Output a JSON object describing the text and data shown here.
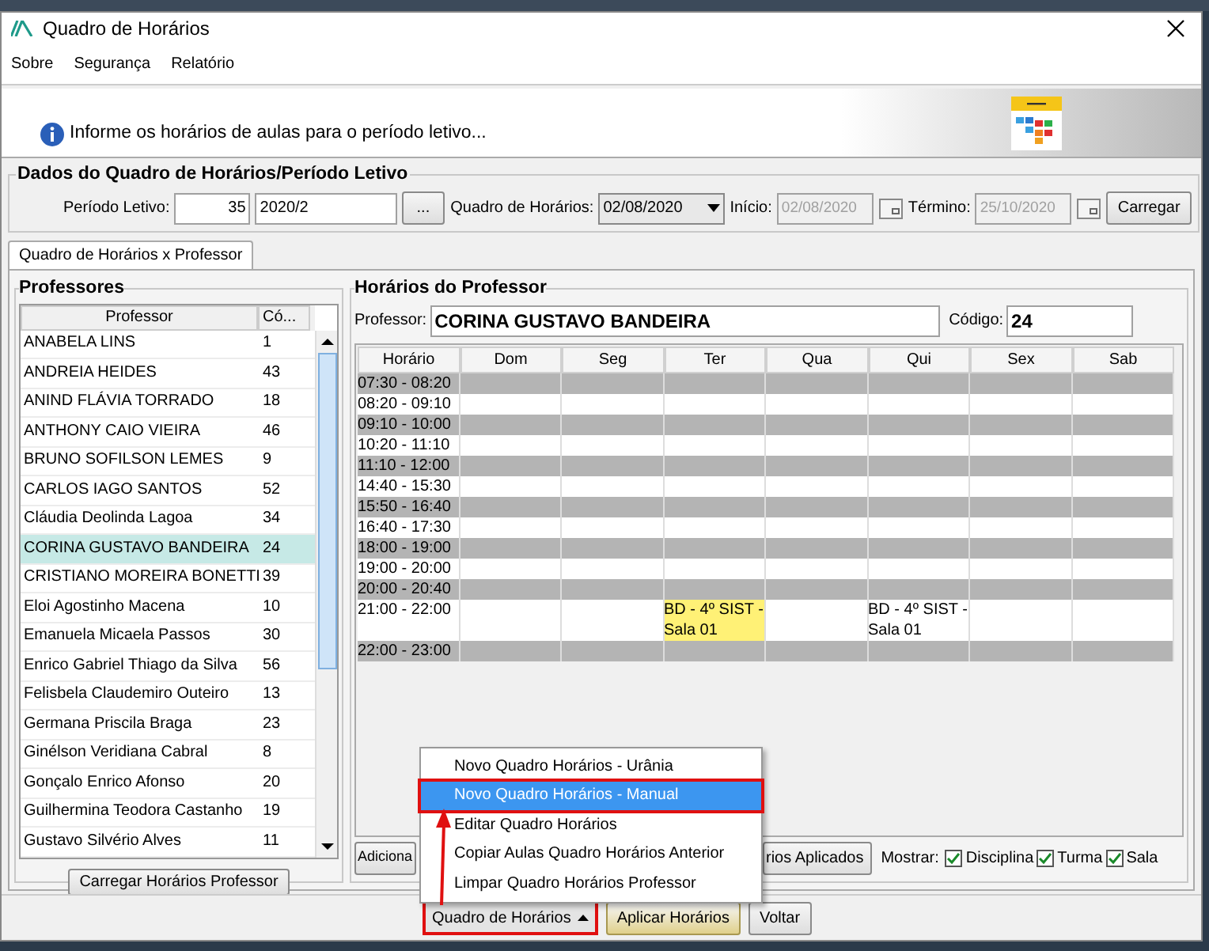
{
  "window": {
    "title": "Quadro de Horários"
  },
  "menu": [
    "Sobre",
    "Segurança",
    "Relatório"
  ],
  "info": "Informe os horários de aulas para o período letivo...",
  "period_group": {
    "title": "Dados do Quadro de Horários/Período Letivo",
    "periodo_label": "Período Letivo:",
    "periodo_code": "35",
    "periodo_value": "2020/2",
    "browse": "...",
    "quadro_label": "Quadro de Horários:",
    "quadro_value": "02/08/2020",
    "inicio_label": "Início:",
    "inicio_value": "02/08/2020",
    "termino_label": "Término:",
    "termino_value": "25/10/2020",
    "load": "Carregar"
  },
  "tabs": [
    {
      "label": "Quadro de Horários x Professor",
      "selected": true
    }
  ],
  "professors": {
    "title": "Professores",
    "columns": [
      "Professor",
      "Có..."
    ],
    "rows": [
      {
        "name": "ANABELA LINS",
        "code": "1",
        "selected": false
      },
      {
        "name": "ANDREIA HEIDES",
        "code": "43",
        "selected": false
      },
      {
        "name": "ANIND FLÁVIA TORRADO",
        "code": "18",
        "selected": false
      },
      {
        "name": "ANTHONY CAIO VIEIRA",
        "code": "46",
        "selected": false
      },
      {
        "name": "BRUNO SOFILSON LEMES",
        "code": "9",
        "selected": false
      },
      {
        "name": "CARLOS IAGO SANTOS",
        "code": "52",
        "selected": false
      },
      {
        "name": "Cláudia Deolinda Lagoa",
        "code": "34",
        "selected": false
      },
      {
        "name": "CORINA GUSTAVO BANDEIRA",
        "code": "24",
        "selected": true
      },
      {
        "name": "CRISTIANO MOREIRA BONETTI",
        "code": "39",
        "selected": false
      },
      {
        "name": "Eloi Agostinho Macena",
        "code": "10",
        "selected": false
      },
      {
        "name": "Emanuela Micaela Passos",
        "code": "30",
        "selected": false
      },
      {
        "name": "Enrico Gabriel Thiago da Silva",
        "code": "56",
        "selected": false
      },
      {
        "name": "Felisbela Claudemiro Outeiro",
        "code": "13",
        "selected": false
      },
      {
        "name": "Germana Priscila Braga",
        "code": "23",
        "selected": false
      },
      {
        "name": "Ginélson Veridiana Cabral",
        "code": "8",
        "selected": false
      },
      {
        "name": "Gonçalo Enrico Afonso",
        "code": "20",
        "selected": false
      },
      {
        "name": "Guilhermina Teodora Castanho",
        "code": "19",
        "selected": false
      },
      {
        "name": "Gustavo Silvério Alves",
        "code": "11",
        "selected": false
      }
    ],
    "load_button": "Carregar Horários Professor"
  },
  "schedule": {
    "title": "Horários do Professor",
    "professor_label": "Professor:",
    "professor_value": "CORINA GUSTAVO BANDEIRA",
    "code_label": "Código:",
    "code_value": "24",
    "columns": [
      "Horário",
      "Dom",
      "Seg",
      "Ter",
      "Qua",
      "Qui",
      "Sex",
      "Sab"
    ],
    "rows": [
      {
        "cells": [
          {
            "text": "07:30 - 08:20"
          }
        ]
      },
      {
        "cells": [
          {
            "text": "08:20 - 09:10"
          }
        ]
      },
      {
        "cells": [
          {
            "text": "09:10 - 10:00"
          }
        ]
      },
      {
        "cells": [
          {
            "text": "10:20 - 11:10"
          }
        ]
      },
      {
        "cells": [
          {
            "text": "11:10 - 12:00"
          }
        ]
      },
      {
        "cells": [
          {
            "text": "14:40 - 15:30"
          }
        ]
      },
      {
        "cells": [
          {
            "text": "15:50 - 16:40"
          }
        ]
      },
      {
        "cells": [
          {
            "text": "16:40 - 17:30"
          }
        ]
      },
      {
        "cells": [
          {
            "text": "18:00 - 19:00"
          }
        ]
      },
      {
        "cells": [
          {
            "text": "19:00 - 20:00"
          }
        ]
      },
      {
        "cells": [
          {
            "text": "20:00 - 20:40"
          }
        ]
      },
      {
        "cells": [
          {
            "text": "21:00 - 22:00"
          },
          {
            "text": ""
          },
          {
            "text": ""
          },
          {
            "text": "BD - 4º SIST - Sala 01",
            "highlighted": true
          },
          {
            "text": ""
          },
          {
            "text": "BD - 4º SIST - Sala 01",
            "highlighted": false
          }
        ]
      },
      {
        "cells": [
          {
            "text": "22:00 - 23:00"
          }
        ]
      }
    ],
    "add_button": "Adiciona",
    "applied_button": "rios Aplicados",
    "show_label": "Mostrar:",
    "show": [
      {
        "label": "Disciplina",
        "checked": true
      },
      {
        "label": "Turma",
        "checked": true
      },
      {
        "label": "Sala",
        "checked": true
      }
    ]
  },
  "popup_menu": [
    {
      "label": "Novo Quadro Horários - Urânia",
      "selected": false
    },
    {
      "label": "Novo Quadro Horários - Manual",
      "selected": true
    },
    {
      "label": "Editar Quadro Horários",
      "selected": false
    },
    {
      "label": "Copiar Aulas Quadro Horários Anterior",
      "selected": false
    },
    {
      "label": "Limpar Quadro Horários Professor",
      "selected": false
    }
  ],
  "bottom_buttons": {
    "quadro": "Quadro de Horários",
    "apply": "Aplicar Horários",
    "back": "Voltar"
  }
}
